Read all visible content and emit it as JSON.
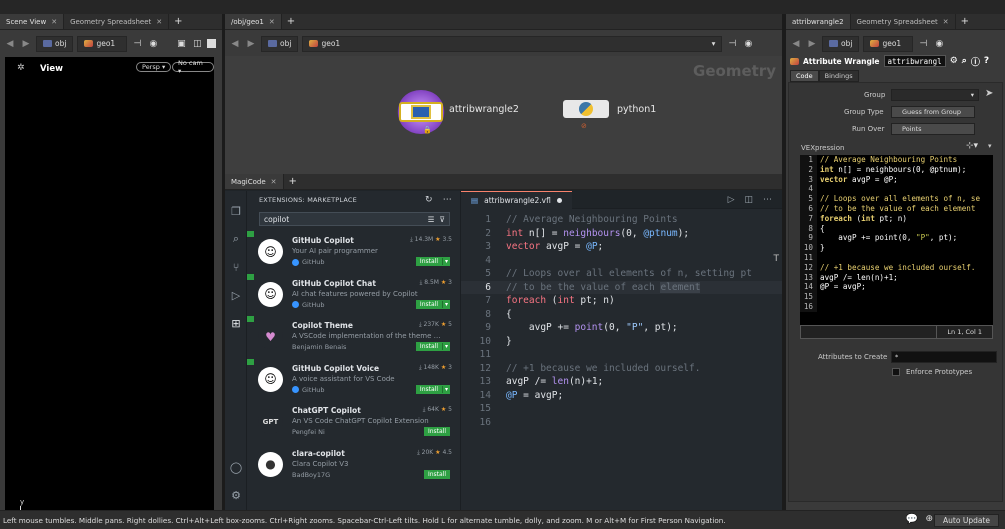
{
  "left_pane": {
    "tabs": [
      {
        "label": "Scene View"
      },
      {
        "label": "Geometry Spreadsheet"
      }
    ],
    "path": {
      "obj": "obj",
      "geo": "geo1"
    },
    "viewport": {
      "title": "View",
      "persp": "Persp ▾",
      "cam": "No cam ▾",
      "axis_y": "y",
      "axis_x": "x"
    }
  },
  "network": {
    "tab": "/obj/geo1",
    "path": {
      "obj": "obj",
      "geo": "geo1"
    },
    "context_label": "Geometry",
    "nodes": [
      {
        "name": "attribwrangle2"
      },
      {
        "name": "python1"
      }
    ]
  },
  "magicode": {
    "tab": "MagiCode",
    "extensions": {
      "header": "EXTENSIONS: MARKETPLACE",
      "search_value": "copilot",
      "items": [
        {
          "name": "GitHub Copilot",
          "desc": "Your AI pair programmer",
          "publisher": "GitHub",
          "downloads": "14.3M",
          "rating": "3.5",
          "install": "Install",
          "avatar": "☺"
        },
        {
          "name": "GitHub Copilot Chat",
          "desc": "AI chat features powered by Copilot",
          "publisher": "GitHub",
          "downloads": "8.5M",
          "rating": "3",
          "install": "Install",
          "avatar": "☺"
        },
        {
          "name": "Copilot Theme",
          "desc": "A VSCode implementation of the theme displa...",
          "publisher": "Benjamin Benais",
          "downloads": "237K",
          "rating": "5",
          "install": "Install",
          "avatar": "♥"
        },
        {
          "name": "GitHub Copilot Voice",
          "desc": "A voice assistant for VS Code",
          "publisher": "GitHub",
          "downloads": "148K",
          "rating": "3",
          "install": "Install",
          "avatar": "☺"
        },
        {
          "name": "ChatGPT Copilot",
          "desc": "An VS Code ChatGPT Copilot Extension",
          "publisher": "Pengfei Ni",
          "downloads": "64K",
          "rating": "5",
          "install": "Install",
          "avatar": "GPT"
        },
        {
          "name": "clara-copilot",
          "desc": "Clara Copilot V3",
          "publisher": "BadBoy17G",
          "downloads": "20K",
          "rating": "4.5",
          "install": "Install",
          "avatar": "●"
        }
      ]
    },
    "editor": {
      "file_tab": "attribwrangle2.vfl",
      "lines": [
        "// Average Neighbouring Points",
        "int n[] = neighbours(0, @ptnum);",
        "vector avgP = @P;",
        "",
        "// Loops over all elements of n, setting pt",
        "// to be the value of each element",
        "foreach (int pt; n)",
        "{",
        "    avgP += point(0, \"P\", pt);",
        "}",
        "",
        "// +1 because we included ourself.",
        "avgP /= len(n)+1;",
        "@P = avgP;",
        "",
        ""
      ],
      "line_numbers": [
        "1",
        "2",
        "3",
        "4",
        "5",
        "6",
        "7",
        "8",
        "9",
        "10",
        "11",
        "12",
        "13",
        "14",
        "15",
        "16"
      ]
    }
  },
  "params": {
    "tabs": [
      {
        "label": "attribwrangle2"
      },
      {
        "label": "Geometry Spreadsheet"
      }
    ],
    "path": {
      "obj": "obj",
      "geo": "geo1"
    },
    "node_type": "Attribute Wrangle",
    "node_name": "attribwrangl",
    "sub_tabs": [
      "Code",
      "Bindings"
    ],
    "group_label": "Group",
    "group_type_label": "Group Type",
    "group_type_value": "Guess from Group",
    "run_over_label": "Run Over",
    "run_over_value": "Points",
    "vex_label": "VEXpression",
    "vex_lines": [
      "// Average Neighbouring Points",
      "int n[] = neighbours(0, @ptnum);",
      "vector avgP = @P;",
      "",
      "// Loops over all elements of n, se",
      "// to be the value of each element",
      "foreach (int pt; n)",
      "{",
      "    avgP += point(0, \"P\", pt);",
      "}",
      "",
      "// +1 because we included ourself.",
      "avgP /= len(n)+1;",
      "@P = avgP;",
      "",
      ""
    ],
    "vex_line_numbers": [
      "1",
      "2",
      "3",
      "4",
      "5",
      "6",
      "7",
      "8",
      "9",
      "10",
      "11",
      "12",
      "13",
      "14",
      "15",
      "16"
    ],
    "cursor_pos": "Ln 1, Col 1",
    "attr_create_label": "Attributes to Create",
    "attr_create_value": "*",
    "enforce_label": "Enforce Prototypes"
  },
  "status": {
    "text": "Left mouse tumbles. Middle pans. Right dollies. Ctrl+Alt+Left box-zooms. Ctrl+Right zooms. Spacebar-Ctrl-Left tilts. Hold L for alternate tumble, dolly, and zoom. M or Alt+M for First Person Navigation.",
    "auto_update": "Auto Update"
  }
}
